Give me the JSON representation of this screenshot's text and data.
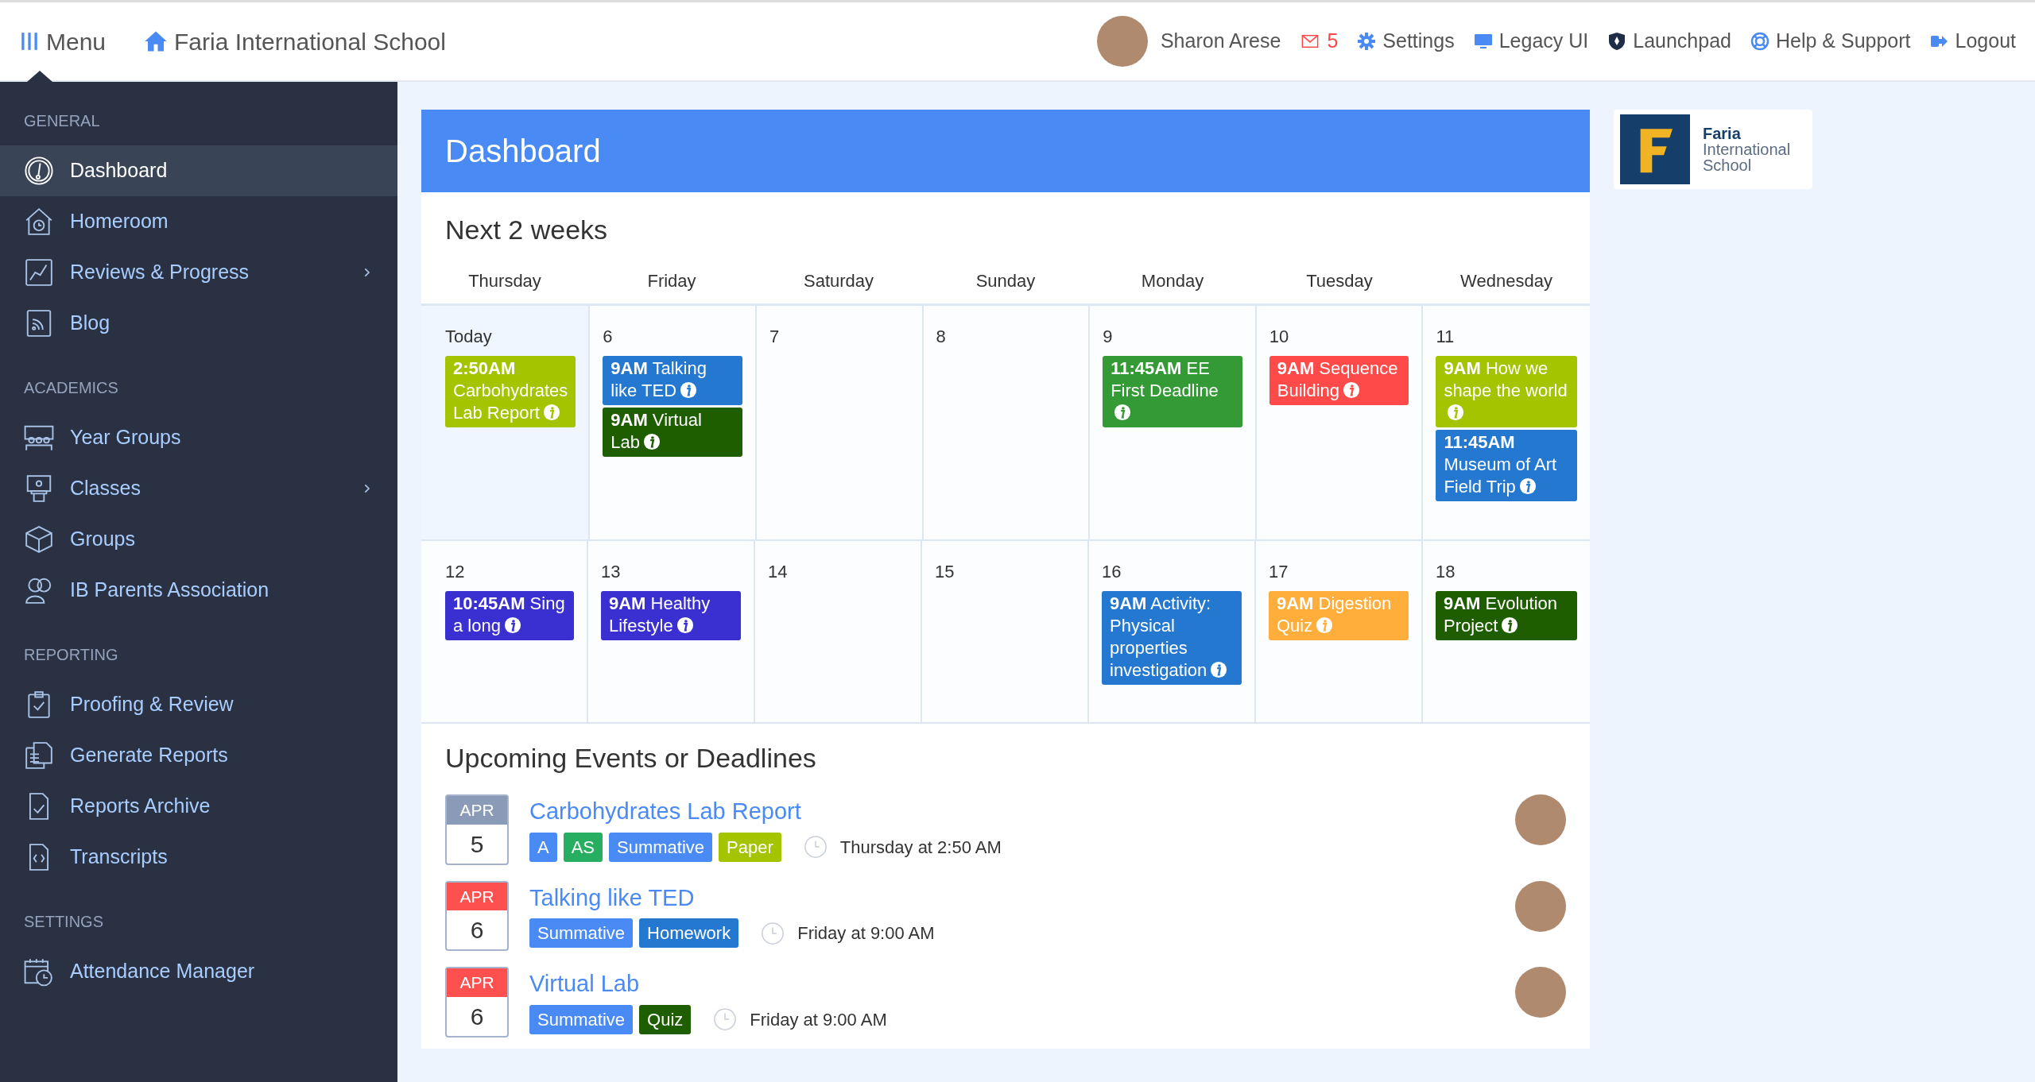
{
  "topbar": {
    "menu_label": "Menu",
    "school": "Faria International School",
    "user": "Sharon Arese",
    "mail_count": "5",
    "links": [
      {
        "kind": "settings",
        "label": "Settings"
      },
      {
        "kind": "monitor",
        "label": "Legacy UI"
      },
      {
        "kind": "rocket",
        "label": "Launchpad"
      },
      {
        "kind": "help",
        "label": "Help & Support"
      },
      {
        "kind": "logout",
        "label": "Logout"
      }
    ]
  },
  "sidebar": {
    "sections": [
      {
        "title": "GENERAL",
        "items": [
          {
            "kind": "gauge",
            "label": "Dashboard",
            "selected": true,
            "submenu": false
          },
          {
            "kind": "house",
            "label": "Homeroom",
            "selected": false,
            "submenu": false
          },
          {
            "kind": "chart",
            "label": "Reviews & Progress",
            "selected": false,
            "submenu": true
          },
          {
            "kind": "rss",
            "label": "Blog",
            "selected": false,
            "submenu": false
          }
        ]
      },
      {
        "title": "ACADEMICS",
        "items": [
          {
            "kind": "people",
            "label": "Year Groups",
            "selected": false,
            "submenu": false
          },
          {
            "kind": "lectern",
            "label": "Classes",
            "selected": false,
            "submenu": true
          },
          {
            "kind": "cube",
            "label": "Groups",
            "selected": false,
            "submenu": false
          },
          {
            "kind": "users",
            "label": "IB Parents Association",
            "selected": false,
            "submenu": false
          }
        ]
      },
      {
        "title": "REPORTING",
        "items": [
          {
            "kind": "clipboard",
            "label": "Proofing & Review",
            "selected": false,
            "submenu": false
          },
          {
            "kind": "docs",
            "label": "Generate Reports",
            "selected": false,
            "submenu": false
          },
          {
            "kind": "filecheck",
            "label": "Reports Archive",
            "selected": false,
            "submenu": false
          },
          {
            "kind": "code",
            "label": "Transcripts",
            "selected": false,
            "submenu": false
          }
        ]
      },
      {
        "title": "SETTINGS",
        "items": [
          {
            "kind": "calendar",
            "label": "Attendance Manager",
            "selected": false,
            "submenu": false
          }
        ]
      }
    ]
  },
  "dashboard": {
    "title": "Dashboard",
    "calendar_title": "Next 2 weeks",
    "weekdays": [
      "Thursday",
      "Friday",
      "Saturday",
      "Sunday",
      "Monday",
      "Tuesday",
      "Wednesday"
    ],
    "weeks": [
      [
        {
          "day": "Today",
          "today": true,
          "events": [
            {
              "text": "**2:50AM** Carbohydrates Lab Report",
              "color": "#a4c400"
            }
          ]
        },
        {
          "day": "6",
          "today": false,
          "events": [
            {
              "text": "**9AM** Talking like TED",
              "color": "#2478d0"
            },
            {
              "text": "**9AM** Virtual Lab",
              "color": "#1e5e00"
            }
          ]
        },
        {
          "day": "7",
          "today": false
        },
        {
          "day": "8",
          "today": false
        },
        {
          "day": "9",
          "today": false,
          "events": [
            {
              "text": "**11:45AM** EE First Deadline",
              "color": "#339a35"
            }
          ]
        },
        {
          "day": "10",
          "today": false,
          "events": [
            {
              "text": "**9AM** Sequence Building",
              "color": "#ff4a4a"
            }
          ]
        },
        {
          "day": "11",
          "today": false,
          "events": [
            {
              "text": "**9AM** How we shape the world",
              "color": "#a4c400"
            },
            {
              "text": "**11:45AM** Museum of Art Field Trip",
              "color": "#2478d0"
            }
          ]
        }
      ],
      [
        {
          "day": "12",
          "today": false,
          "events": [
            {
              "text": "**10:45AM** Sing a long",
              "color": "#3a2fd0"
            }
          ]
        },
        {
          "day": "13",
          "today": false,
          "events": [
            {
              "text": "**9AM** Healthy Lifestyle",
              "color": "#3a2fd0"
            }
          ]
        },
        {
          "day": "14",
          "today": false
        },
        {
          "day": "15",
          "today": false
        },
        {
          "day": "16",
          "today": false,
          "events": [
            {
              "text": "**9AM** Activity: Physical properties investigation",
              "color": "#2478d0"
            }
          ]
        },
        {
          "day": "17",
          "today": false,
          "events": [
            {
              "text": "**9AM** Digestion Quiz",
              "color": "#ffad3b"
            }
          ]
        },
        {
          "day": "18",
          "today": false,
          "events": [
            {
              "text": "**9AM** Evolution Project",
              "color": "#1e5e00"
            }
          ]
        }
      ]
    ],
    "upcoming_title": "Upcoming Events or Deadlines",
    "upcoming": [
      {
        "month": "APR",
        "day": "5",
        "color": "#8a9bb8",
        "title": "Carbohydrates Lab Report",
        "tags": [
          {
            "label": "A",
            "color": "#4a8af4"
          },
          {
            "label": "AS",
            "color": "#27ae60"
          },
          {
            "label": "Summative",
            "color": "#4a8af4"
          },
          {
            "label": "Paper",
            "color": "#a4c400"
          }
        ],
        "when": "Thursday at 2:50 AM"
      },
      {
        "month": "APR",
        "day": "6",
        "color": "#ff5050",
        "title": "Talking like TED",
        "tags": [
          {
            "label": "Summative",
            "color": "#4a8af4"
          },
          {
            "label": "Homework",
            "color": "#2478d0"
          }
        ],
        "when": "Friday at 9:00 AM"
      },
      {
        "month": "APR",
        "day": "6",
        "color": "#ff5050",
        "title": "Virtual Lab",
        "tags": [
          {
            "label": "Summative",
            "color": "#4a8af4"
          },
          {
            "label": "Quiz",
            "color": "#1e5e00"
          }
        ],
        "when": "Friday at 9:00 AM"
      }
    ]
  },
  "school_logo": {
    "name_bold": "Faria",
    "name_rest": "International School"
  }
}
